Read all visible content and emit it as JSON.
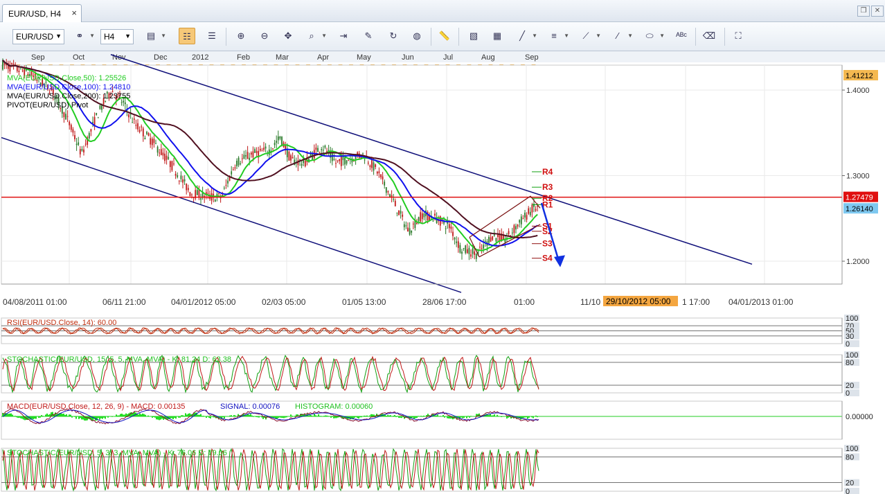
{
  "tab": {
    "title": "EUR/USD, H4",
    "close": "×"
  },
  "toolbar": {
    "symbol": "EUR/USD",
    "timeframe": "H4"
  },
  "months": [
    "Sep",
    "Oct",
    "Nov",
    "Dec",
    "2012",
    "Feb",
    "Mar",
    "Apr",
    "May",
    "Jun",
    "Jul",
    "Aug",
    "Sep"
  ],
  "legend": [
    "MVA(EUR/USD.Close,50): 1.25526",
    "MVA(EUR/USD.Close,100): 1.24810",
    "MVA(EUR/USD.Close,200): 1.23755",
    "PIVOT(EUR/USD) Pivot"
  ],
  "price_axis": {
    "ticks": [
      "1.4000",
      "1.3000",
      "1.2000"
    ],
    "badge_top": "1.41212",
    "badge_red": "1.27479",
    "badge_blue": "1.26140"
  },
  "pivots": [
    "R4",
    "R3",
    "R2",
    "R1",
    "S1",
    "S2",
    "S3",
    "S4"
  ],
  "time_axis": [
    "04/08/2011 01:00",
    "06/11 21:00",
    "04/01/2012 05:00",
    "02/03 05:00",
    "01/05 13:00",
    "28/06 17:00",
    "01:00",
    "11/10",
    "29/10/2012 05:00",
    "1 17:00",
    "04/01/2013 01:00"
  ],
  "rsi": {
    "label": "RSI(EUR/USD.Close, 14): 60.00",
    "ticks": [
      "100",
      "70",
      "50",
      "30",
      "0"
    ]
  },
  "stoch1": {
    "label": "STOCHASTIC(EUR/USD, 15, 5, 5, MVA, MVA) -  K: 81.24  D: 63.38",
    "ticks": [
      "100",
      "80",
      "20",
      "0"
    ]
  },
  "macd": {
    "label_main": "MACD(EUR/USD.Close, 12, 26, 9) -  MACD: 0.00135",
    "label_signal": "SIGNAL: 0.00076",
    "label_hist": "HISTOGRAM: 0.00060",
    "tick": "0.00000"
  },
  "stoch2": {
    "label": "STOCHASTIC(EUR/USD, 5, 3, 3, MVA, MVA) -  K: 76.06  D: 79.06",
    "ticks": [
      "100",
      "80",
      "20",
      "0"
    ]
  },
  "colors": {
    "bull": "#2a7a2a",
    "bear": "#c01818",
    "ma50": "#22cc22",
    "ma100": "#1010ee",
    "ma200": "#501020",
    "channel": "#10107a",
    "resistance": "#e01010"
  }
}
